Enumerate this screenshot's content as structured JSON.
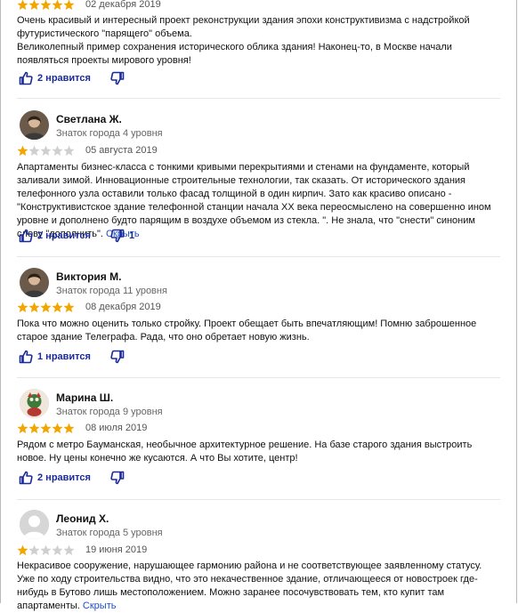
{
  "reviews": [
    {
      "rating": 5,
      "date": "02 декабря 2019",
      "paragraphs": [
        "Очень красивый и интересный проект реконструкции здания эпохи конструктивизма с надстройкой футуристического \"парящего\" объема.",
        "Великолепный пример сохранения исторического облика здания! Наконец-то, в Москве начали появляться проекты мирового уровня!"
      ],
      "likes_label": "2 нравится",
      "dislikes_label": ""
    },
    {
      "author": "Светлана Ж.",
      "level": "Знаток города 4 уровня",
      "avatar": "photo-avatar",
      "rating": 1,
      "date": "05 августа 2019",
      "paragraphs": [
        "Апартаменты бизнес-класса с тонкими кривыми перекрытиями и стенами на фундаменте, который заливали зимой. Инновационные строительные технологии, так сказать. От исторического здания телефонного узла оставили только фасад толщиной в один кирпич. Зато как красиво описано - \"Конструктивистское здание телефонной станции начала XX века переосмыслено на совершенно ином уровне и дополнено будто парящим в воздухе объемом из стекла. \". Не знала, что \"снести\" синоним слову \"дополнить\"."
      ],
      "hide_label": "Скрыть",
      "likes_label": "2 нравится",
      "dislikes_label": "1"
    },
    {
      "author": "Виктория М.",
      "level": "Знаток города 11 уровня",
      "avatar": "photo-avatar",
      "rating": 5,
      "date": "08 декабря 2019",
      "paragraphs": [
        "Пока что можно оценить только стройку. Проект обещает быть впечатляющим! Помню заброшенное старое здание Телеграфа. Рада, что оно обретает новую жизнь."
      ],
      "likes_label": "1 нравится",
      "dislikes_label": ""
    },
    {
      "author": "Марина Ш.",
      "level": "Знаток города 9 уровня",
      "avatar": "toy-avatar",
      "rating": 5,
      "date": "08 июля 2019",
      "paragraphs": [
        "Рядом с метро Бауманская, необычное архитектурное решение. На базе старого здания выстроить новое. Ну цены конечно же кусаются. А что Вы хотите, центр!"
      ],
      "likes_label": "2 нравится",
      "dislikes_label": ""
    },
    {
      "author": "Леонид Х.",
      "level": "Знаток города 5 уровня",
      "avatar": "default-user-avatar",
      "rating": 1,
      "date": "19 июня 2019",
      "paragraphs": [
        "Некрасивое сооружение, нарушающее гармонию района и не соответствующее заявленному статусу. Уже по ходу строительства видно, что это некачественное здание, отличающееся от новостроек где-нибудь в Бутово лишь местоположением. Можно заранее посочувствовать тем, кто купит там апартаменты."
      ],
      "hide_label": "Скрыть",
      "likes_label": "",
      "dislikes_label": ""
    }
  ],
  "colors": {
    "star_filled": "#f0a500",
    "star_empty": "#cfcfcf",
    "link": "#1a4fc7",
    "like_count": "#1a2a99"
  }
}
